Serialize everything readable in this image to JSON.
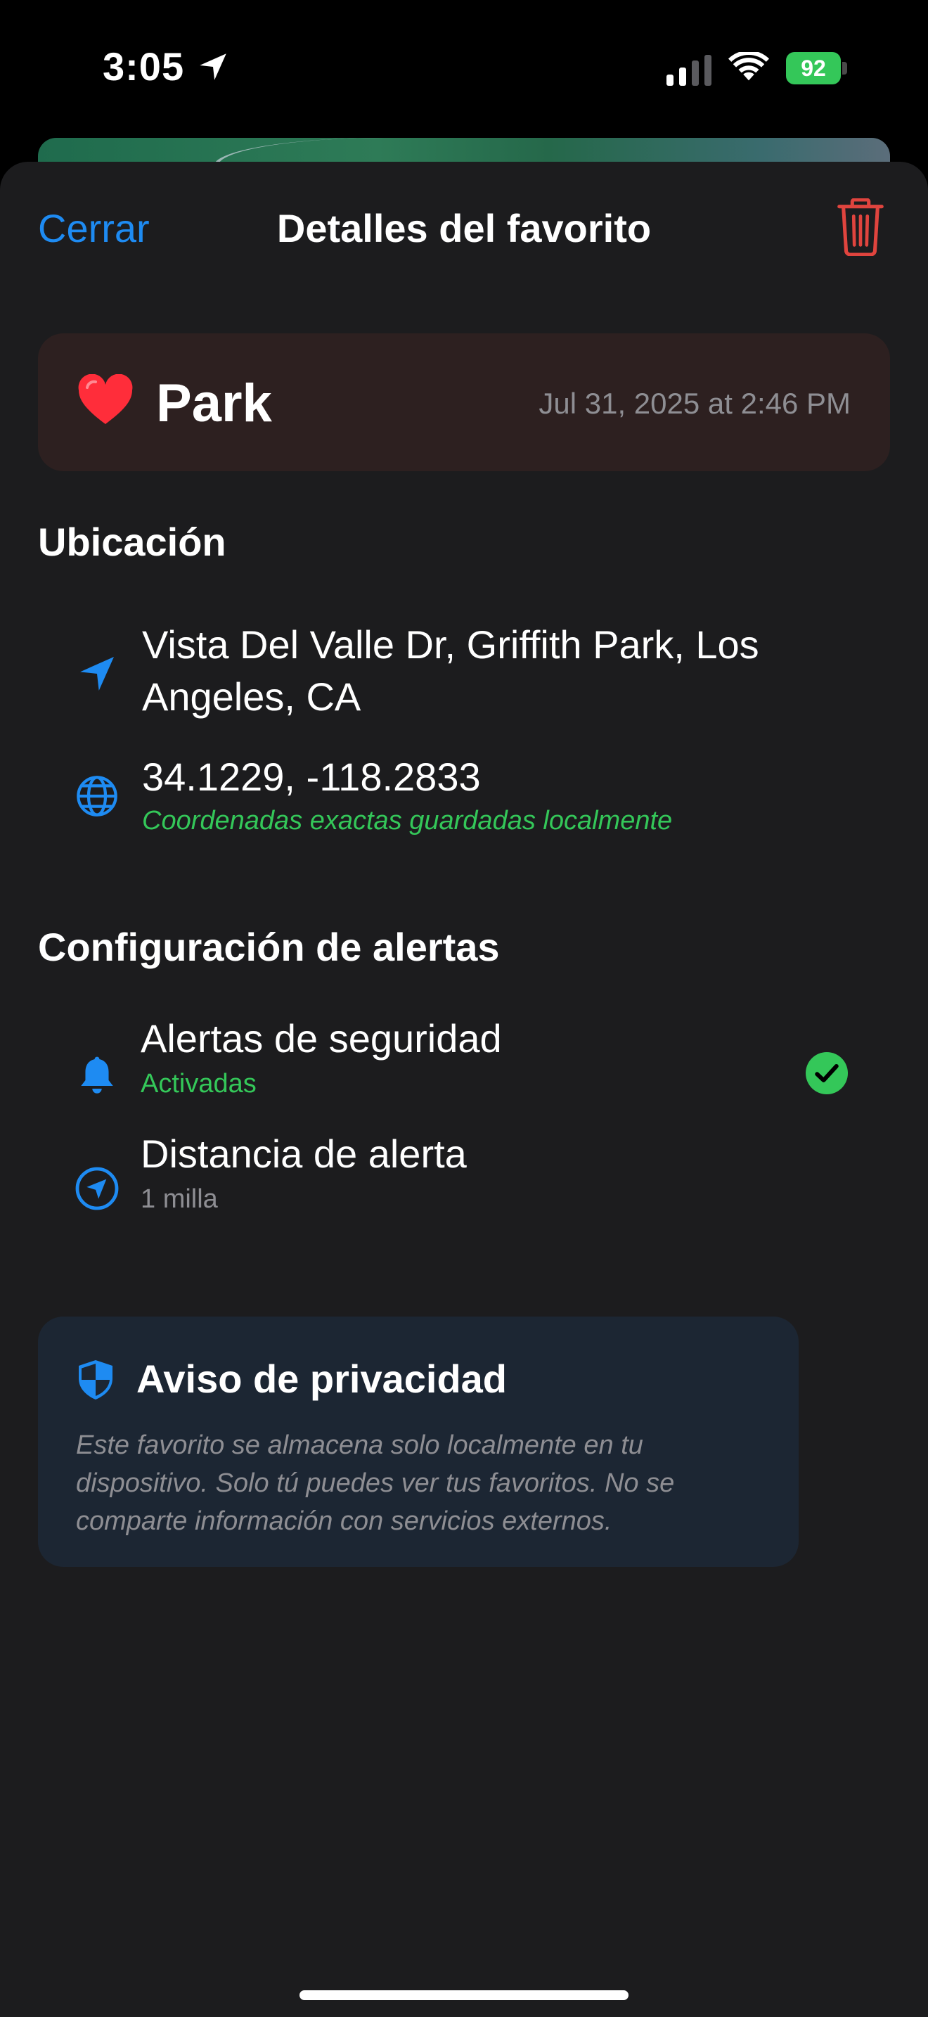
{
  "status_bar": {
    "time": "3:05",
    "battery": "92"
  },
  "header": {
    "close_label": "Cerrar",
    "title": "Detalles del favorito",
    "trash_icon": "trash-icon"
  },
  "favorite": {
    "emoji": "heart-icon",
    "name": "Park",
    "date": "Jul 31, 2025 at 2:46 PM"
  },
  "location_section": {
    "title": "Ubicación",
    "address_line1": "Vista Del Valle Dr, Griffith Park, Los",
    "address_line2": "Angeles, CA",
    "coordinates": "34.1229, -118.2833",
    "coordinates_note": "Coordenadas exactas guardadas localmente"
  },
  "alerts_section": {
    "title": "Configuración de alertas",
    "safety_alerts_label": "Alertas de seguridad",
    "safety_alerts_status": "Activadas",
    "distance_label": "Distancia de alerta",
    "distance_value": "1 milla"
  },
  "privacy": {
    "title": "Aviso de privacidad",
    "text": "Este favorito se almacena solo localmente en tu dispositivo. Solo tú puedes ver tus favoritos. No se comparte información con servicios externos."
  },
  "colors": {
    "accent_blue": "#1e8bf2",
    "destructive_red": "#e0443e",
    "success_green": "#34c759",
    "sheet_bg": "#1c1c1e"
  }
}
